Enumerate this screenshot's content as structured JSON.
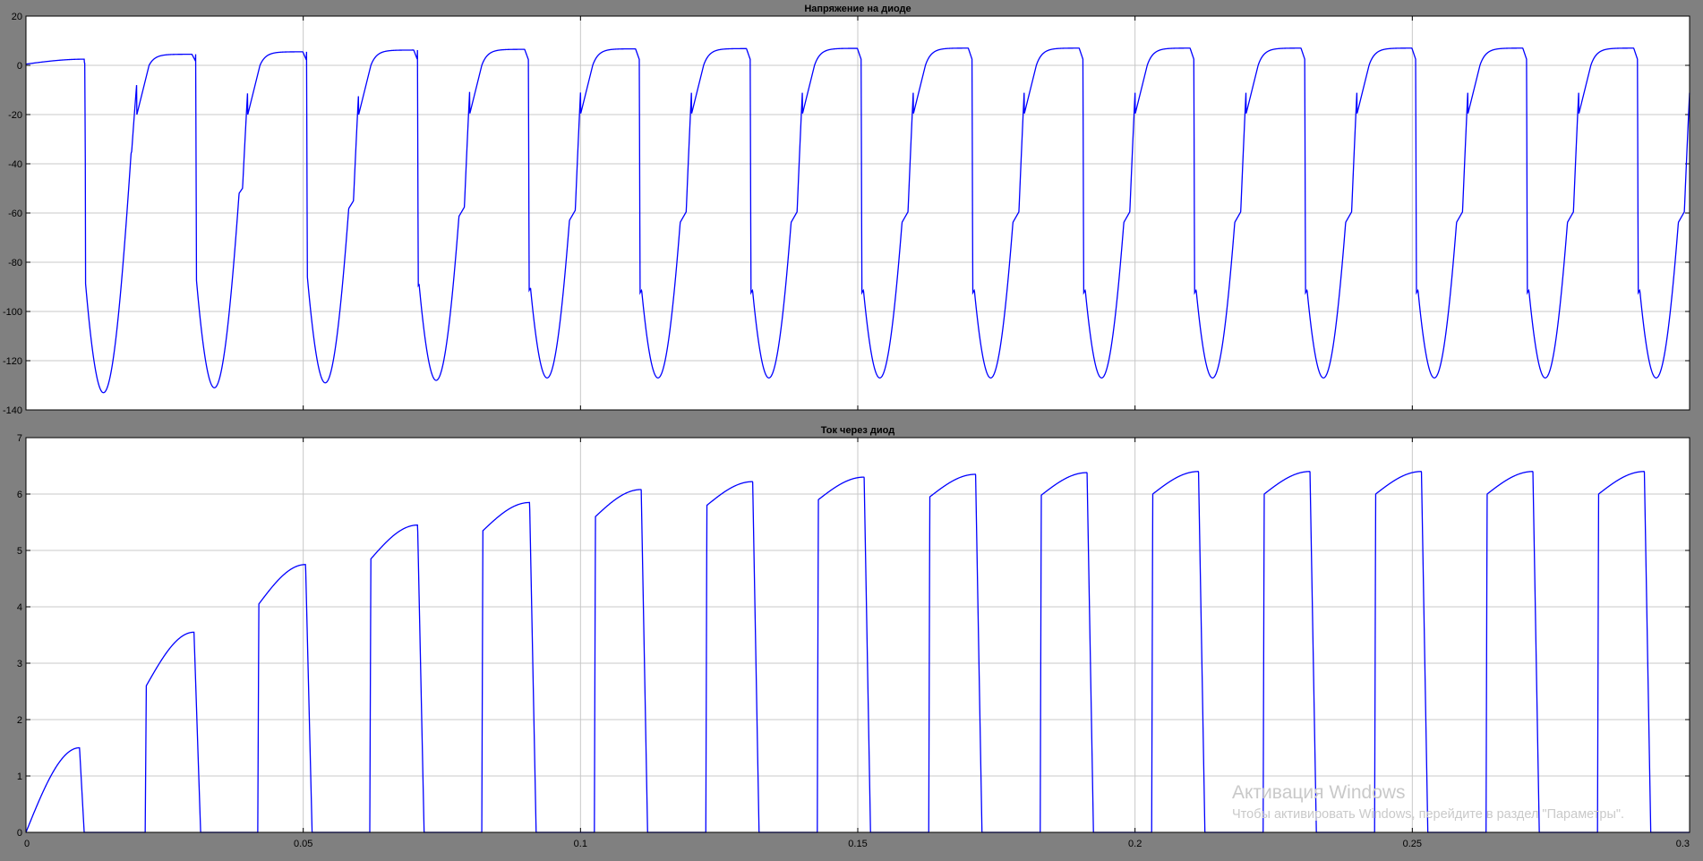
{
  "chart_data": [
    {
      "type": "line",
      "title": "Напряжение на диоде",
      "xlim": [
        0,
        0.3
      ],
      "ylim": [
        -140,
        20
      ],
      "xticks": [
        0,
        0.05,
        0.1,
        0.15,
        0.2,
        0.25,
        0.3
      ],
      "yticks": [
        -140,
        -120,
        -100,
        -80,
        -60,
        -40,
        -20,
        0,
        20
      ],
      "xticklabels": [
        "",
        "",
        "",
        "",
        "",
        "",
        ""
      ],
      "yticklabels": [
        "-140",
        "-120",
        "-100",
        "-80",
        "-60",
        "-40",
        "-20",
        "0",
        "20"
      ],
      "grid": true,
      "line_color": "#0000ff",
      "period": 0.02,
      "conduction_start_offset": 0.0022,
      "blocking_start_offset": 0.0106,
      "first_conduction_end": 0.0105,
      "reverse_minima": [
        -133,
        -131,
        -129,
        -128,
        -127,
        -127,
        -127,
        -127,
        -127,
        -127,
        -127,
        -127,
        -127,
        -127,
        -127
      ],
      "forward_plateau": [
        2.5,
        4.5,
        5.5,
        6.2,
        6.5,
        6.7,
        6.8,
        6.9,
        7.0,
        7.0,
        7.0,
        7.0,
        7.0,
        7.0,
        7.0
      ],
      "switch_off_notch": [
        -55,
        -78,
        -86,
        -90,
        -92,
        -93,
        -93,
        -93,
        -93,
        -93,
        -93,
        -93,
        -93,
        -93,
        -93
      ]
    },
    {
      "type": "line",
      "title": "Ток через диод",
      "xlim": [
        0,
        0.3
      ],
      "ylim": [
        0,
        7
      ],
      "xticks": [
        0,
        0.05,
        0.1,
        0.15,
        0.2,
        0.25,
        0.3
      ],
      "yticks": [
        0,
        1,
        2,
        3,
        4,
        5,
        6,
        7
      ],
      "xticklabels": [
        "0",
        "0.05",
        "0.1",
        "0.15",
        "0.2",
        "0.25",
        "0.3"
      ],
      "yticklabels": [
        "0",
        "1",
        "2",
        "3",
        "4",
        "5",
        "6",
        "7"
      ],
      "grid": true,
      "line_color": "#0000ff",
      "period": 0.02,
      "pulse_start": [
        0.0,
        0.0215,
        0.0418,
        0.062,
        0.0822,
        0.1025,
        0.1226,
        0.1427,
        0.1628,
        0.1829,
        0.203,
        0.2231,
        0.2432,
        0.2633,
        0.2834
      ],
      "pulse_end": [
        0.0105,
        0.0315,
        0.0516,
        0.0718,
        0.092,
        0.1121,
        0.1322,
        0.1523,
        0.1724,
        0.1925,
        0.2126,
        0.2327,
        0.2528,
        0.2729,
        0.293
      ],
      "pulse_start_value": [
        0.0,
        2.6,
        4.05,
        4.85,
        5.35,
        5.6,
        5.8,
        5.9,
        5.95,
        5.98,
        6.0,
        6.0,
        6.0,
        6.0,
        6.0
      ],
      "pulse_peak_value": [
        1.5,
        3.55,
        4.75,
        5.45,
        5.85,
        6.08,
        6.22,
        6.3,
        6.35,
        6.38,
        6.4,
        6.4,
        6.4,
        6.4,
        6.4
      ]
    }
  ],
  "watermark": {
    "title": "Активация Windows",
    "text": "Чтобы активировать Windows, перейдите в раздел \"Параметры\"."
  }
}
